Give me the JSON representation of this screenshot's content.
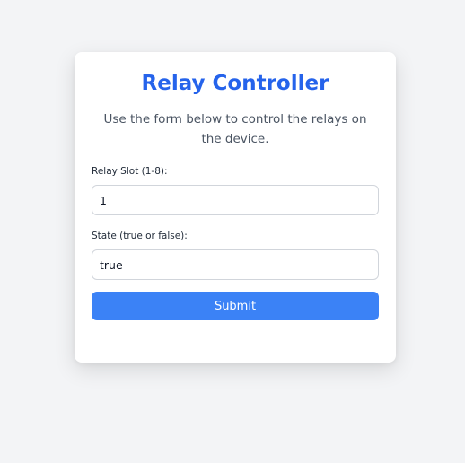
{
  "page": {
    "background": "#f3f4f6"
  },
  "card": {
    "title": "Relay Controller",
    "title_color": "#2563eb",
    "description": "Use the form below to control the relays on the device."
  },
  "form": {
    "relay_slot": {
      "label": "Relay Slot (1-8):",
      "value": "1"
    },
    "state": {
      "label": "State (true or false):",
      "value": "true"
    },
    "submit_label": "Submit",
    "submit_color": "#3b82f6"
  }
}
